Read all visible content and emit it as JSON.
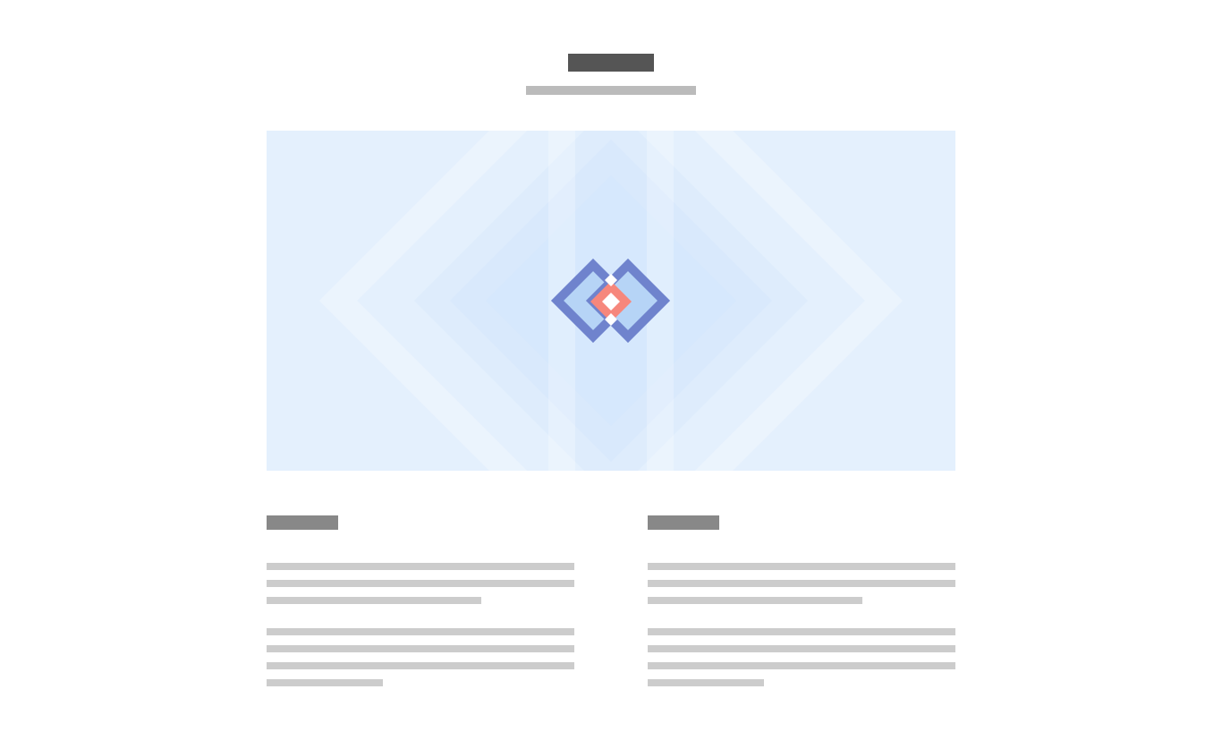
{
  "colors": {
    "title_block": "#555555",
    "subtitle_line": "#bbbbbb",
    "hero_bg": "#e4f0fd",
    "diamond_outline": "#6f83cd",
    "diamond_fill": "#b6d4f6",
    "diamond_accent": "#f6877c",
    "heading_block": "#888888",
    "text_line": "#cccccc"
  },
  "hero": {
    "icon": "diamond-logo-icon"
  },
  "columns": [
    {
      "name": "left",
      "paragraphs": [
        3,
        4
      ]
    },
    {
      "name": "right",
      "paragraphs": [
        3,
        4
      ]
    }
  ]
}
